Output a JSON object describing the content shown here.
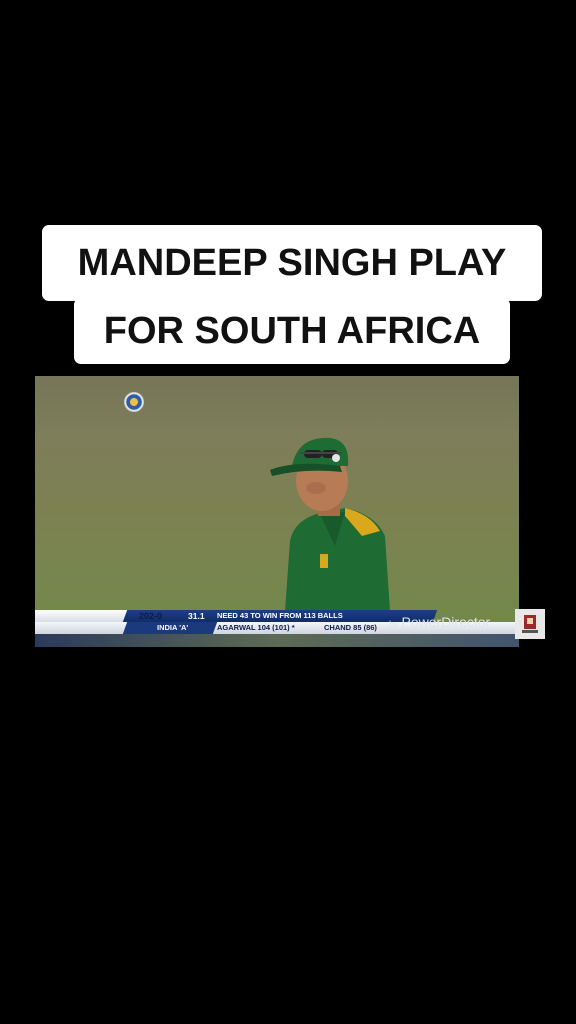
{
  "caption": {
    "line1": "MANDEEP SINGH PLAY",
    "line2": "FOR SOUTH AFRICA"
  },
  "scoreboard": {
    "score": "202-0",
    "overs": "31.1",
    "need": "NEED 43 TO WIN FROM 113 BALLS",
    "team": "INDIA 'A'",
    "batsman1": "AGARWAL  104 (101) *",
    "batsman2": "CHAND  85 (86)"
  },
  "watermark": {
    "by": "by",
    "text": "PowerDirector"
  },
  "icons": {
    "broadcaster_logo": "bcci-logo-icon",
    "badge": "app-badge-icon"
  },
  "colors": {
    "background": "#000000",
    "scoreboard_blue": "#1d3f86",
    "jersey_green": "#1f6b34",
    "jersey_yellow": "#d9a81c"
  }
}
